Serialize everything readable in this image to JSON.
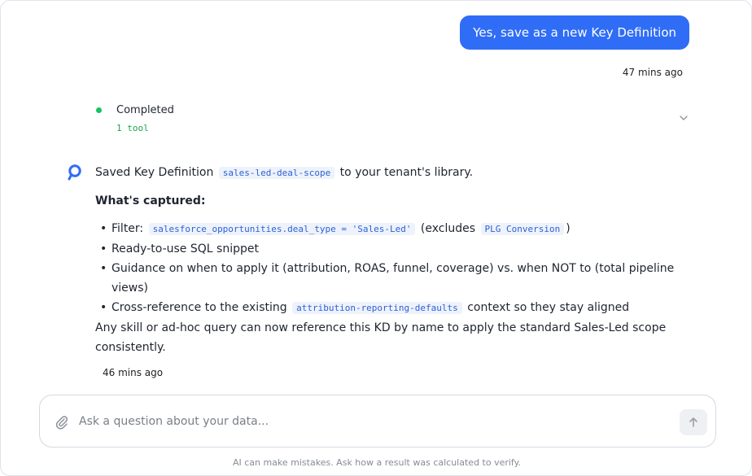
{
  "user_message": {
    "text": "Yes, save as a new Key Definition",
    "time": "47 mins ago"
  },
  "tool_status": {
    "status": "Completed",
    "count": "1 tool"
  },
  "assistant_message": {
    "intro_before": "Saved Key Definition ",
    "intro_code": "sales-led-deal-scope",
    "intro_after": " to your tenant's library.",
    "heading": "What's captured:",
    "bullet_1_label": "Filter: ",
    "bullet_1_code": "salesforce_opportunities.deal_type = 'Sales-Led'",
    "bullet_1_middle": " (excludes ",
    "bullet_1_code_2": "PLG Conversion",
    "bullet_1_end": ")",
    "bullet_2": "Ready-to-use SQL snippet",
    "bullet_3": "Guidance on when to apply it (attribution, ROAS, funnel, coverage) vs. when NOT to (total pipeline views)",
    "bullet_4_before": "Cross-reference to the existing ",
    "bullet_4_code": "attribution-reporting-defaults",
    "bullet_4_after": " context so they stay aligned",
    "closing": "Any skill or ad-hoc query can now reference this KD by name to apply the standard Sales-Led scope consistently.",
    "time": "46 mins ago"
  },
  "composer": {
    "placeholder": "Ask a question about your data...",
    "icons": {
      "attach": "paperclip-icon",
      "send": "arrow-up-icon"
    }
  },
  "footer": {
    "disclaimer": "AI can make mistakes. Ask how a result was calculated to verify."
  },
  "colors": {
    "primary": "#2f6df6",
    "success": "#16c45f",
    "code_text": "#2d61d8",
    "code_bg": "#eef2fb"
  }
}
